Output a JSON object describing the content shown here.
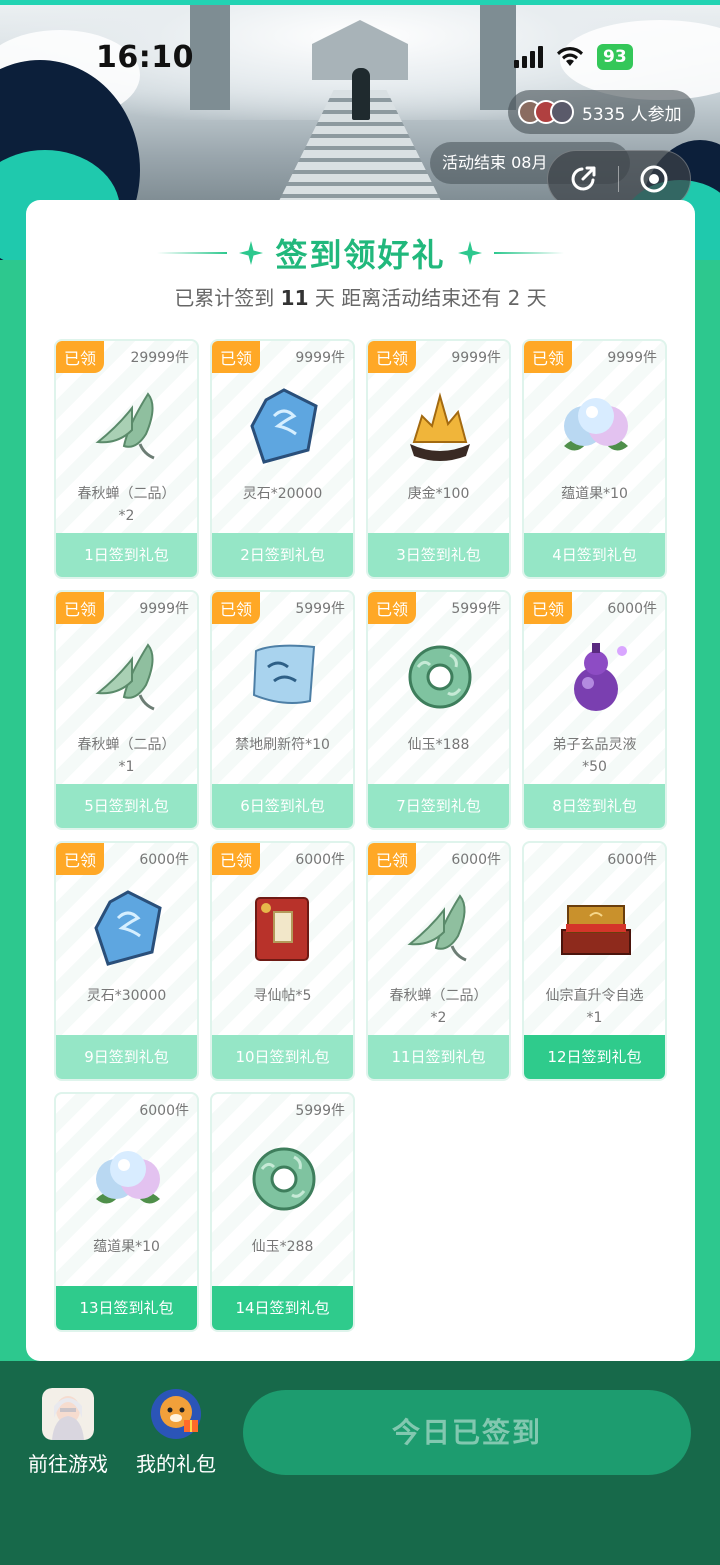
{
  "status_bar": {
    "time": "16:10",
    "battery": "93"
  },
  "header": {
    "participants": "5335 人参加",
    "activity_end": "活动结束 08月"
  },
  "card": {
    "title": "签到领好礼",
    "subtitle_prefix": "已累计签到 ",
    "days_signed": "11",
    "subtitle_mid": " 天  距离活动结束还有 2 天"
  },
  "rewards": [
    {
      "tag": "已领",
      "stock": "29999件",
      "name": "春秋蝉（二品）",
      "qty": "*2",
      "day_label": "1日签到礼包",
      "icon": "cicada-icon"
    },
    {
      "tag": "已领",
      "stock": "9999件",
      "name": "灵石*20000",
      "qty": "",
      "day_label": "2日签到礼包",
      "icon": "spirit-stone-icon"
    },
    {
      "tag": "已领",
      "stock": "9999件",
      "name": "庚金*100",
      "qty": "",
      "day_label": "3日签到礼包",
      "icon": "gold-ore-icon"
    },
    {
      "tag": "已领",
      "stock": "9999件",
      "name": "蕴道果*10",
      "qty": "",
      "day_label": "4日签到礼包",
      "icon": "dao-fruit-icon"
    },
    {
      "tag": "已领",
      "stock": "9999件",
      "name": "春秋蝉（二品）",
      "qty": "*1",
      "day_label": "5日签到礼包",
      "icon": "cicada-icon"
    },
    {
      "tag": "已领",
      "stock": "5999件",
      "name": "禁地刷新符*10",
      "qty": "",
      "day_label": "6日签到礼包",
      "icon": "talisman-icon"
    },
    {
      "tag": "已领",
      "stock": "5999件",
      "name": "仙玉*188",
      "qty": "",
      "day_label": "7日签到礼包",
      "icon": "jade-ring-icon"
    },
    {
      "tag": "已领",
      "stock": "6000件",
      "name": "弟子玄品灵液",
      "qty": "*50",
      "day_label": "8日签到礼包",
      "icon": "gourd-icon"
    },
    {
      "tag": "已领",
      "stock": "6000件",
      "name": "灵石*30000",
      "qty": "",
      "day_label": "9日签到礼包",
      "icon": "spirit-stone-icon"
    },
    {
      "tag": "已领",
      "stock": "6000件",
      "name": "寻仙帖*5",
      "qty": "",
      "day_label": "10日签到礼包",
      "icon": "red-book-icon"
    },
    {
      "tag": "已领",
      "stock": "6000件",
      "name": "春秋蝉（二品）",
      "qty": "*2",
      "day_label": "11日签到礼包",
      "icon": "cicada-icon"
    },
    {
      "tag": "",
      "stock": "6000件",
      "name": "仙宗直升令自选",
      "qty": "*1",
      "day_label": "12日签到礼包",
      "icon": "token-box-icon"
    },
    {
      "tag": "",
      "stock": "6000件",
      "name": "蕴道果*10",
      "qty": "",
      "day_label": "13日签到礼包",
      "icon": "dao-fruit-icon"
    },
    {
      "tag": "",
      "stock": "5999件",
      "name": "仙玉*288",
      "qty": "",
      "day_label": "14日签到礼包",
      "icon": "jade-ring-icon"
    }
  ],
  "bottom": {
    "go_game": "前往游戏",
    "my_gifts": "我的礼包",
    "checkin_button": "今日已签到"
  },
  "colors": {
    "accent": "#2dc88e",
    "tag": "#ffa826",
    "bottom_bar": "#17694a"
  }
}
